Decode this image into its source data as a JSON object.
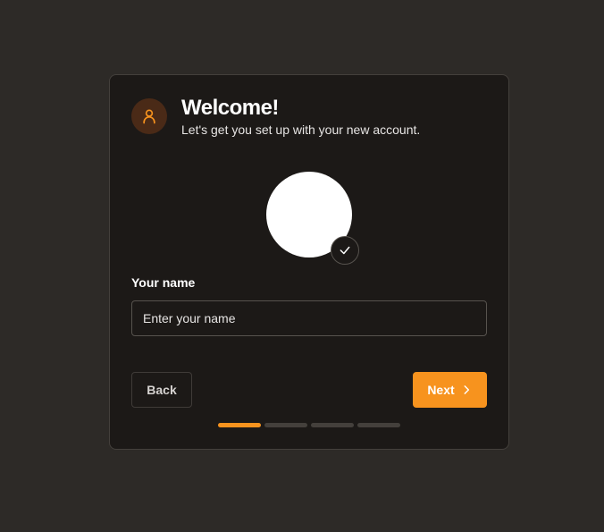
{
  "header": {
    "icon": "user-icon",
    "title": "Welcome!",
    "subtitle": "Let's get you set up with your new account."
  },
  "avatar": {
    "badge_icon": "check-icon"
  },
  "name_field": {
    "label": "Your name",
    "placeholder": "Enter your name",
    "value": ""
  },
  "actions": {
    "back_label": "Back",
    "next_label": "Next",
    "next_icon": "chevron-right-icon"
  },
  "progress": {
    "total_steps": 4,
    "current_step": 1
  },
  "colors": {
    "accent": "#f7931e",
    "background": "#2d2a27",
    "card": "#1c1917"
  }
}
